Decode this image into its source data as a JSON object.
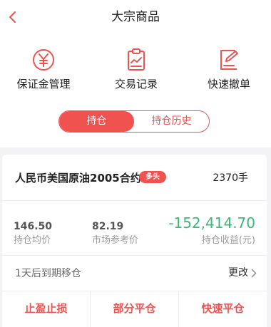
{
  "header": {
    "title": "大宗商品",
    "back_icon": "chevron-left-icon"
  },
  "quick_actions": [
    {
      "label": "保证金管理",
      "icon": "yuan-circle-icon"
    },
    {
      "label": "交易记录",
      "icon": "clipboard-icon"
    },
    {
      "label": "快速撤单",
      "icon": "edit-doc-icon"
    }
  ],
  "tabs": [
    {
      "label": "持仓",
      "active": true
    },
    {
      "label": "持仓历史",
      "active": false
    }
  ],
  "position": {
    "name": "人民币美国原油2005合约",
    "direction_badge": "多头",
    "quantity": "2370手",
    "avg_price": "146.50",
    "avg_price_label": "持仓均价",
    "market_ref_price": "82.19",
    "market_ref_price_label": "市场参考价",
    "pnl": "-152,414.70",
    "pnl_label": "持仓收益(元)",
    "rollover_text": "1天后到期移仓",
    "change_label": "更改"
  },
  "actions": [
    {
      "label": "止盈止损"
    },
    {
      "label": "部分平仓"
    },
    {
      "label": "快速平仓"
    }
  ],
  "colors": {
    "accent": "#f0524f",
    "gain_green": "#3cb878"
  }
}
